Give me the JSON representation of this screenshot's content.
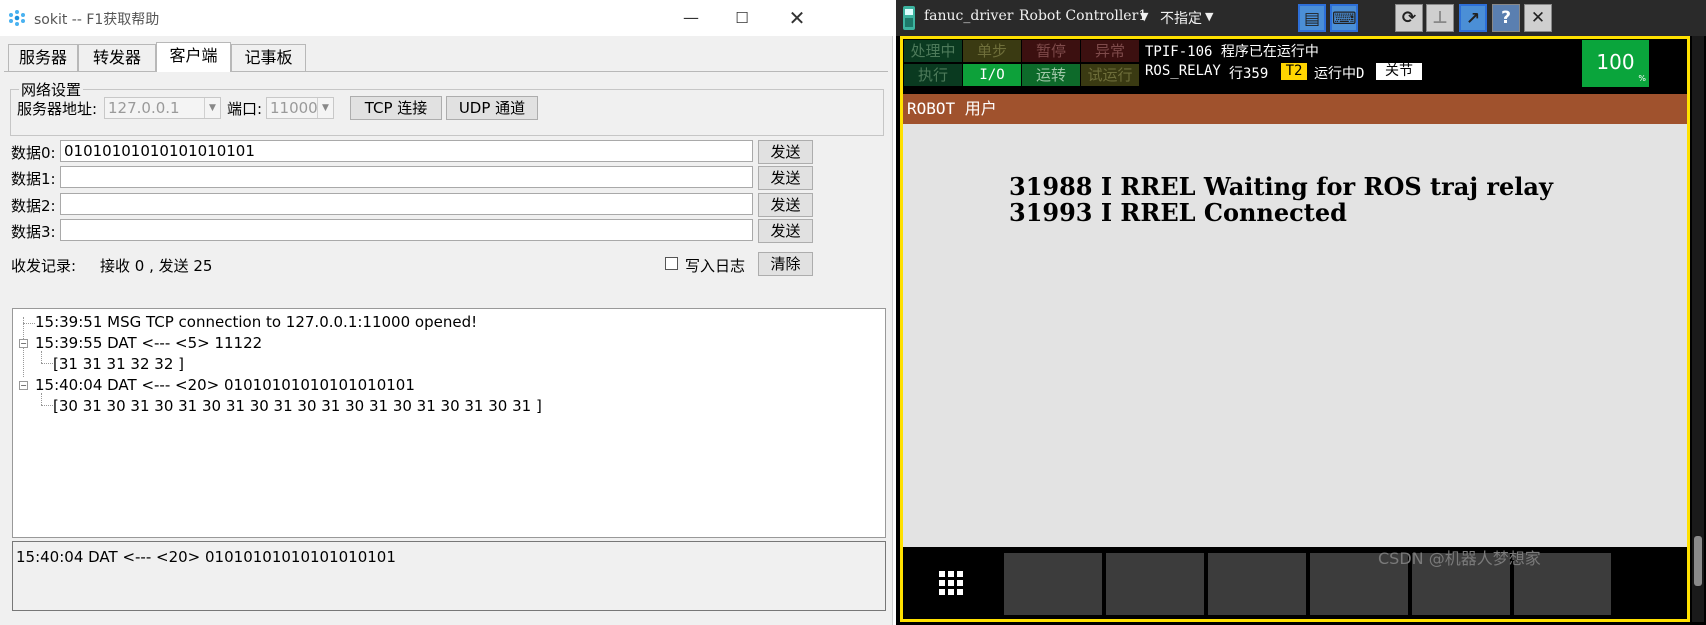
{
  "sokit": {
    "title": "sokit -- F1获取帮助",
    "tabs": [
      "服务器",
      "转发器",
      "客户端",
      "记事板"
    ],
    "active_tab": "客户端",
    "network": {
      "legend": "网络设置",
      "server_label": "服务器地址:",
      "server_value": "127.0.0.1",
      "port_label": "端口:",
      "port_value": "11000",
      "tcp_button": "TCP 连接",
      "udp_button": "UDP 通道"
    },
    "data_rows": [
      {
        "label": "数据0:",
        "value": "01010101010101010101",
        "send": "发送"
      },
      {
        "label": "数据1:",
        "value": "",
        "send": "发送"
      },
      {
        "label": "数据2:",
        "value": "",
        "send": "发送"
      },
      {
        "label": "数据3:",
        "value": "",
        "send": "发送"
      }
    ],
    "record": {
      "label": "收发记录:",
      "counts": "接收 0 , 发送 25",
      "log_checkbox_label": "写入日志",
      "clear_button": "清除"
    },
    "log": [
      "15:39:51 MSG TCP connection to 127.0.0.1:11000 opened!",
      "15:39:55 DAT <--- <5> 11122",
      "[31 31 31 32 32 ]",
      "15:40:04 DAT <--- <20> 01010101010101010101",
      "[30 31 30 31 30 31 30 31 30 31 30 31 30 31 30 31 30 31 30 31 ]"
    ],
    "status_text": "15:40:04 DAT <--- <20> 01010101010101010101"
  },
  "fanuc": {
    "tab_name": "fanuc_driver",
    "controller": "Robot Controller1",
    "unspecified": "不指定",
    "status": {
      "row1": [
        "处理中",
        "单步",
        "暂停",
        "异常"
      ],
      "row2": [
        "执行",
        "I/O",
        "运转",
        "试运行"
      ]
    },
    "message_line1": "TPIF-106 程序已在运行中",
    "message_line2_prog": "ROS_RELAY",
    "message_line2_line": "行359",
    "message_line2_mode": "T2",
    "message_line2_state": "运行中D",
    "message_line2_joint": "关节",
    "override": "100",
    "override_unit": "%",
    "screen_title": "ROBOT 用户",
    "screen_lines": [
      "31988 I RREL Waiting for ROS traj relay",
      "31993 I RREL Connected"
    ],
    "colors": {
      "frame": "#ffe100",
      "header": "#a0522d",
      "screen": "#e3e3e3"
    }
  },
  "watermark": "CSDN @机器人梦想家"
}
